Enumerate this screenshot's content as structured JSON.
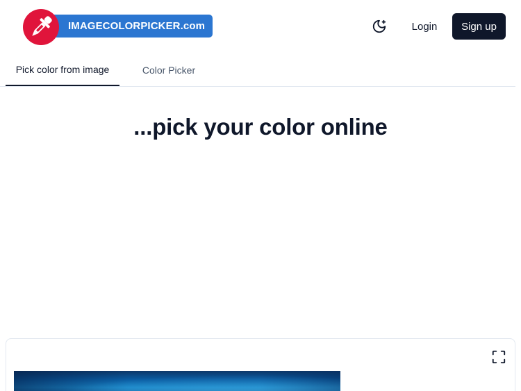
{
  "header": {
    "logo_text": "IMAGECOLORPICKER.com",
    "logo_icon": "eyedropper-icon",
    "theme_icon": "moon-stars-icon",
    "login_label": "Login",
    "signup_label": "Sign up"
  },
  "tabs": [
    {
      "label": "Pick color from image",
      "active": true
    },
    {
      "label": "Color Picker",
      "active": false
    }
  ],
  "main": {
    "title": "...pick your color online"
  },
  "card": {
    "expand_icon": "fullscreen-icon"
  },
  "colors": {
    "brand_blue": "#2b76d1",
    "brand_red": "#e0143b",
    "dark": "#0f172a",
    "muted": "#475569",
    "border": "#e2e8f0"
  }
}
